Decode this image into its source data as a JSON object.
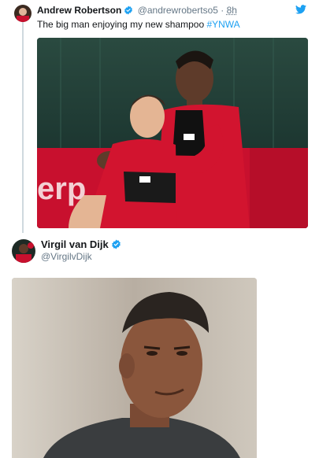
{
  "tweet": {
    "author_name": "Andrew Robertson",
    "handle": "@andrewrobertso5",
    "separator": "·",
    "time": "8h",
    "text": "The big man enjoying my new shampoo ",
    "hashtag": "#YNWA",
    "twitter_icon": "twitter-bird-icon"
  },
  "reply": {
    "author_name": "Virgil van Dijk",
    "handle": "@VirgilvDijk"
  },
  "colors": {
    "link_blue": "#1da1f2",
    "secondary_text": "#657786",
    "liverpool_red": "#c8102e"
  }
}
